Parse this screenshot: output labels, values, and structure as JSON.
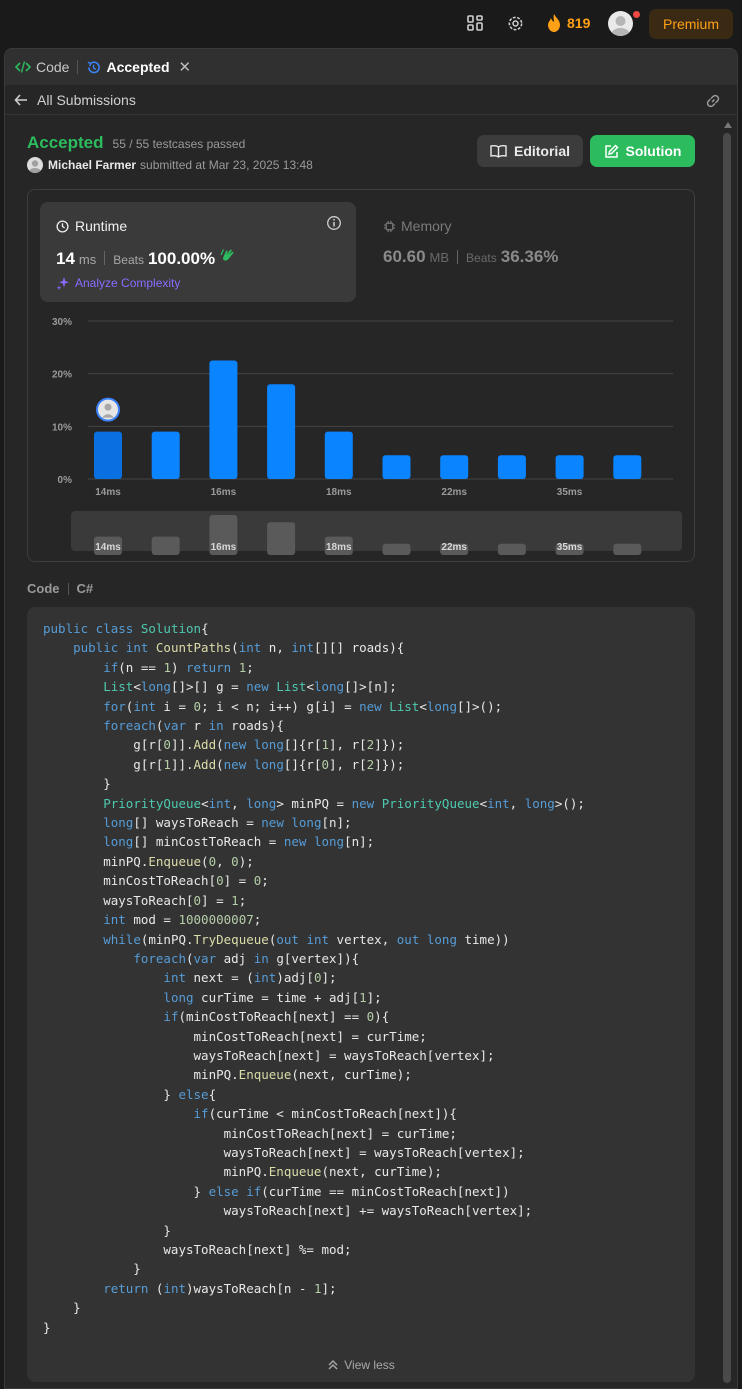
{
  "topbar": {
    "streak_count": "819",
    "premium_label": "Premium"
  },
  "tabs": [
    {
      "label": "Code",
      "icon": "code-icon"
    },
    {
      "label": "Accepted",
      "icon": "history-icon"
    }
  ],
  "subheader": {
    "back_label": "All Submissions"
  },
  "submission": {
    "status": "Accepted",
    "testcases": "55 / 55 testcases passed",
    "author": "Michael Farmer",
    "submitted_text": "submitted at Mar 23, 2025 13:48",
    "editorial_label": "Editorial",
    "solution_label": "Solution"
  },
  "runtime": {
    "title": "Runtime",
    "value": "14",
    "unit": "ms",
    "beats_label": "Beats",
    "beats": "100.00%",
    "analyze_label": "Analyze Complexity"
  },
  "memory": {
    "title": "Memory",
    "value": "60.60",
    "unit": "MB",
    "beats_label": "Beats",
    "beats": "36.36%"
  },
  "colors": {
    "accent_green": "#2cbb5d",
    "bar_blue": "#0a84ff",
    "premium_orange": "#ffa116",
    "ai_purple": "#8b6cff"
  },
  "chart_data": {
    "type": "bar",
    "y_ticks": [
      "30%",
      "20%",
      "10%",
      "0%"
    ],
    "ylim": [
      0,
      30
    ],
    "x_labels": [
      "14ms",
      "",
      "16ms",
      "",
      "18ms",
      "",
      "22ms",
      "",
      "35ms",
      ""
    ],
    "values": [
      9,
      9,
      22.5,
      18,
      9,
      4.5,
      4.5,
      4.5,
      4.5,
      4.5
    ],
    "highlight_index": 0
  },
  "code": {
    "label": "Code",
    "language": "C#",
    "view_less_label": "View less"
  }
}
